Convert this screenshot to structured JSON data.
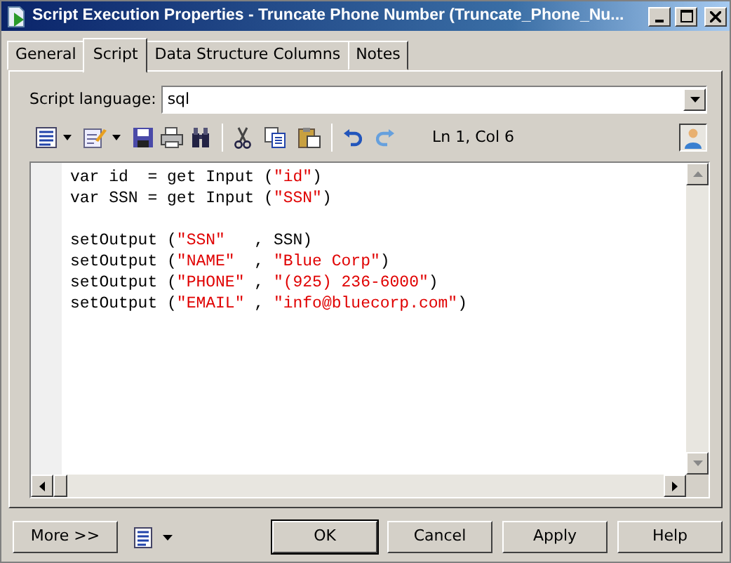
{
  "window": {
    "title": "Script Execution Properties - Truncate Phone Number (Truncate_Phone_Nu..."
  },
  "tabs": [
    {
      "label": "General",
      "selected": false
    },
    {
      "label": "Script",
      "selected": true
    },
    {
      "label": "Data Structure Columns",
      "selected": false
    },
    {
      "label": "Notes",
      "selected": false
    }
  ],
  "script_language": {
    "label": "Script language:",
    "value": "sql"
  },
  "toolbar": {
    "position": "Ln 1, Col 6"
  },
  "editor": {
    "lines": [
      [
        {
          "kind": "plain",
          "text": "var id  = get Input ("
        },
        {
          "kind": "string",
          "text": "\"id\""
        },
        {
          "kind": "plain",
          "text": ")"
        }
      ],
      [
        {
          "kind": "plain",
          "text": "var SSN = get Input ("
        },
        {
          "kind": "string",
          "text": "\"SSN\""
        },
        {
          "kind": "plain",
          "text": ")"
        }
      ],
      [
        {
          "kind": "blank"
        }
      ],
      [
        {
          "kind": "plain",
          "text": "setOutput ("
        },
        {
          "kind": "string",
          "text": "\"SSN\""
        },
        {
          "kind": "plain",
          "text": "   , SSN)"
        }
      ],
      [
        {
          "kind": "plain",
          "text": "setOutput ("
        },
        {
          "kind": "string",
          "text": "\"NAME\""
        },
        {
          "kind": "plain",
          "text": "  , "
        },
        {
          "kind": "string",
          "text": "\"Blue Corp\""
        },
        {
          "kind": "plain",
          "text": ")"
        }
      ],
      [
        {
          "kind": "plain",
          "text": "setOutput ("
        },
        {
          "kind": "string",
          "text": "\"PHONE\""
        },
        {
          "kind": "plain",
          "text": " , "
        },
        {
          "kind": "string",
          "text": "\"(925) 236-6000\""
        },
        {
          "kind": "plain",
          "text": ")"
        }
      ],
      [
        {
          "kind": "plain",
          "text": "setOutput ("
        },
        {
          "kind": "string",
          "text": "\"EMAIL\""
        },
        {
          "kind": "plain",
          "text": " , "
        },
        {
          "kind": "string",
          "text": "\"info@bluecorp.com\""
        },
        {
          "kind": "plain",
          "text": ")"
        }
      ]
    ]
  },
  "buttons": {
    "more": "More >>",
    "ok": "OK",
    "cancel": "Cancel",
    "apply": "Apply",
    "help": "Help"
  }
}
